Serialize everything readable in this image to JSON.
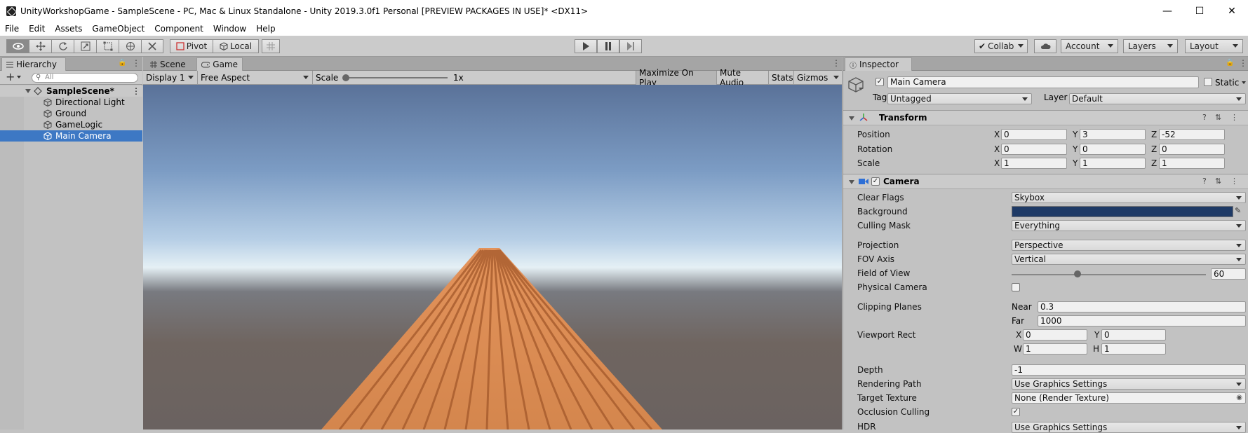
{
  "window": {
    "title": "UnityWorkshopGame - SampleScene - PC, Mac & Linux Standalone - Unity 2019.3.0f1 Personal [PREVIEW PACKAGES IN USE]* <DX11>",
    "minimize": "—",
    "maximize": "☐",
    "close": "✕"
  },
  "menu": [
    "File",
    "Edit",
    "Assets",
    "GameObject",
    "Component",
    "Window",
    "Help"
  ],
  "toolbar": {
    "pivot": "Pivot",
    "local": "Local",
    "collab": "Collab",
    "account": "Account",
    "layers": "Layers",
    "layout": "Layout"
  },
  "hierarchy": {
    "tab": "Hierarchy",
    "search_placeholder": "All",
    "scene": "SampleScene*",
    "items": [
      "Directional Light",
      "Ground",
      "GameLogic",
      "Main Camera"
    ],
    "selected_index": 3
  },
  "game": {
    "tabs": [
      "Scene",
      "Game"
    ],
    "active_tab": "Game",
    "display": "Display 1",
    "aspect": "Free Aspect",
    "scale_label": "Scale",
    "scale_value": "1x",
    "buttons": [
      "Maximize On Play",
      "Mute Audio",
      "Stats",
      "Gizmos"
    ]
  },
  "inspector": {
    "tab": "Inspector",
    "object_name": "Main Camera",
    "static_label": "Static",
    "tag_label": "Tag",
    "tag_value": "Untagged",
    "layer_label": "Layer",
    "layer_value": "Default",
    "transform": {
      "title": "Transform",
      "rows": [
        {
          "label": "Position",
          "x": "0",
          "y": "3",
          "z": "-52"
        },
        {
          "label": "Rotation",
          "x": "0",
          "y": "0",
          "z": "0"
        },
        {
          "label": "Scale",
          "x": "1",
          "y": "1",
          "z": "1"
        }
      ]
    },
    "camera": {
      "title": "Camera",
      "clear_flags_label": "Clear Flags",
      "clear_flags": "Skybox",
      "background_label": "Background",
      "background_color": "#1e3a66",
      "culling_mask_label": "Culling Mask",
      "culling_mask": "Everything",
      "projection_label": "Projection",
      "projection": "Perspective",
      "fov_axis_label": "FOV Axis",
      "fov_axis": "Vertical",
      "fov_label": "Field of View",
      "fov": "60",
      "fov_slider_fraction": 0.34,
      "physical_camera_label": "Physical Camera",
      "clipping_label": "Clipping Planes",
      "near_label": "Near",
      "near": "0.3",
      "far_label": "Far",
      "far": "1000",
      "viewport_label": "Viewport Rect",
      "viewport": {
        "x": "0",
        "y": "0",
        "w": "1",
        "h": "1"
      },
      "depth_label": "Depth",
      "depth": "-1",
      "rendering_path_label": "Rendering Path",
      "rendering_path": "Use Graphics Settings",
      "target_texture_label": "Target Texture",
      "target_texture": "None (Render Texture)",
      "occlusion_label": "Occlusion Culling",
      "hdr_label": "HDR",
      "hdr": "Use Graphics Settings"
    }
  }
}
